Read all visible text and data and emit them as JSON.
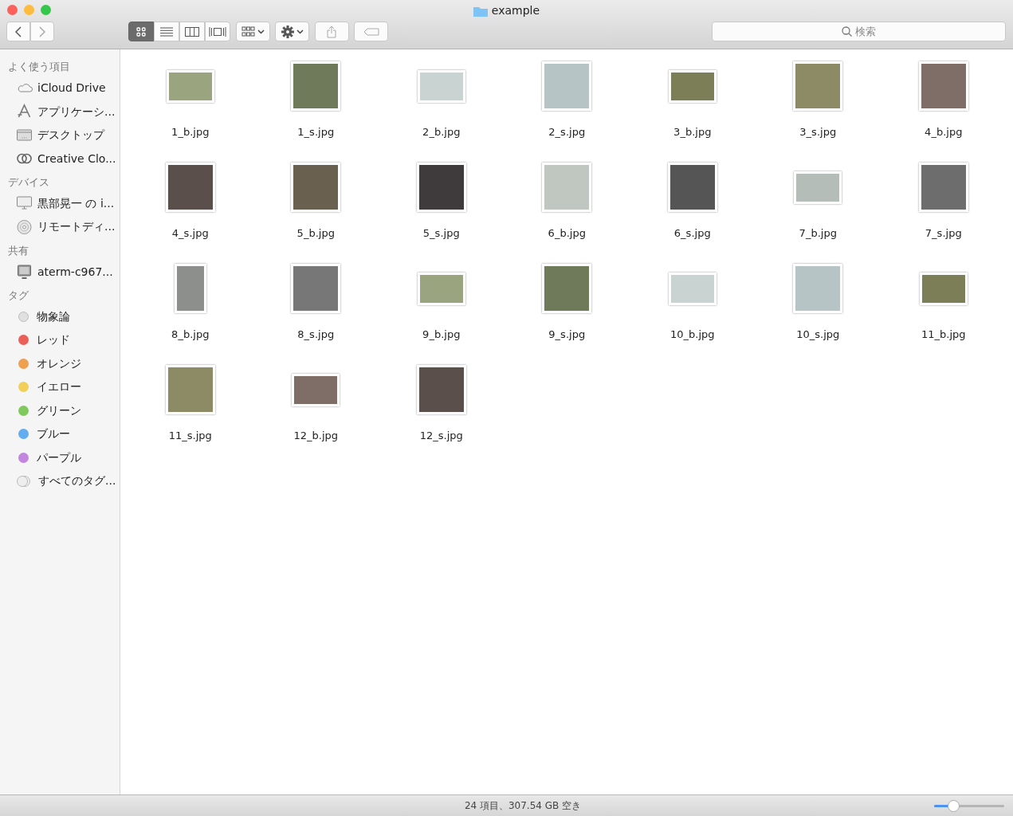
{
  "window": {
    "title": "example"
  },
  "toolbar": {
    "view_modes": [
      {
        "kind": "icons",
        "selected": true
      },
      {
        "kind": "list",
        "selected": false
      },
      {
        "kind": "columns",
        "selected": false
      },
      {
        "kind": "coverflow",
        "selected": false
      }
    ],
    "search": {
      "placeholder": "検索"
    }
  },
  "sidebar": [
    {
      "heading": "よく使う項目",
      "items": [
        {
          "kind": "cloud",
          "label": "iCloud Drive"
        },
        {
          "kind": "apps",
          "label": "アプリケーシ..."
        },
        {
          "kind": "desktop",
          "label": "デスクトップ"
        },
        {
          "kind": "creative",
          "label": "Creative Clo..."
        }
      ]
    },
    {
      "heading": "デバイス",
      "items": [
        {
          "kind": "monitor",
          "label": "黒部晃一 の i..."
        },
        {
          "kind": "disc",
          "label": "リモートディ..."
        }
      ]
    },
    {
      "heading": "共有",
      "items": [
        {
          "kind": "server",
          "label": "aterm-c967..."
        }
      ]
    },
    {
      "heading": "タグ",
      "items": [
        {
          "kind": "tag",
          "color": "#e0e0e0",
          "label": "物象論"
        },
        {
          "kind": "tag",
          "color": "#ec5f59",
          "label": "レッド"
        },
        {
          "kind": "tag",
          "color": "#efa04e",
          "label": "オレンジ"
        },
        {
          "kind": "tag",
          "color": "#f2cf5b",
          "label": "イエロー"
        },
        {
          "kind": "tag",
          "color": "#80c95f",
          "label": "グリーン"
        },
        {
          "kind": "tag",
          "color": "#63aef0",
          "label": "ブルー"
        },
        {
          "kind": "tag",
          "color": "#c386e0",
          "label": "パープル"
        },
        {
          "kind": "alltags",
          "label": "すべてのタグ..."
        }
      ]
    }
  ],
  "files": [
    {
      "name": "1_b.jpg",
      "kind": "wide"
    },
    {
      "name": "1_s.jpg",
      "kind": "square"
    },
    {
      "name": "2_b.jpg",
      "kind": "wide"
    },
    {
      "name": "2_s.jpg",
      "kind": "square"
    },
    {
      "name": "3_b.jpg",
      "kind": "wide"
    },
    {
      "name": "3_s.jpg",
      "kind": "square"
    },
    {
      "name": "4_b.jpg",
      "kind": "square"
    },
    {
      "name": "4_s.jpg",
      "kind": "square"
    },
    {
      "name": "5_b.jpg",
      "kind": "square"
    },
    {
      "name": "5_s.jpg",
      "kind": "square"
    },
    {
      "name": "6_b.jpg",
      "kind": "square"
    },
    {
      "name": "6_s.jpg",
      "kind": "square"
    },
    {
      "name": "7_b.jpg",
      "kind": "wide"
    },
    {
      "name": "7_s.jpg",
      "kind": "square"
    },
    {
      "name": "8_b.jpg",
      "kind": "tall"
    },
    {
      "name": "8_s.jpg",
      "kind": "square"
    },
    {
      "name": "9_b.jpg",
      "kind": "wide"
    },
    {
      "name": "9_s.jpg",
      "kind": "square"
    },
    {
      "name": "10_b.jpg",
      "kind": "wide"
    },
    {
      "name": "10_s.jpg",
      "kind": "square"
    },
    {
      "name": "11_b.jpg",
      "kind": "wide"
    },
    {
      "name": "11_s.jpg",
      "kind": "square"
    },
    {
      "name": "12_b.jpg",
      "kind": "wide"
    },
    {
      "name": "12_s.jpg",
      "kind": "square"
    }
  ],
  "status_bar": {
    "text": "24 項目、307.54 GB 空き",
    "zoom": {
      "level": 0.27
    }
  }
}
